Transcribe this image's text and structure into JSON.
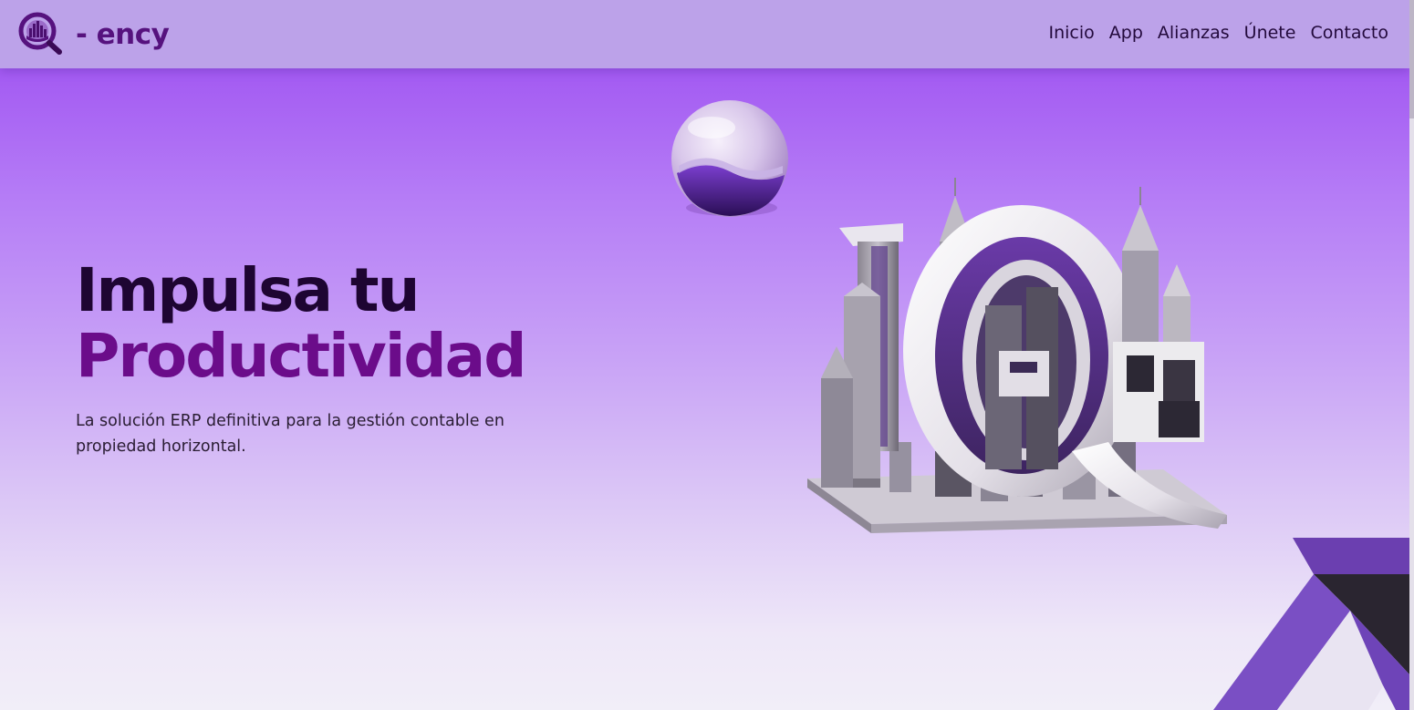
{
  "header": {
    "brand": "- ency",
    "nav": [
      {
        "label": "Inicio"
      },
      {
        "label": "App"
      },
      {
        "label": "Alianzas"
      },
      {
        "label": "Únete"
      },
      {
        "label": "Contacto"
      }
    ]
  },
  "hero": {
    "title_line1": "Impulsa tu",
    "title_line2": "Productividad",
    "subtitle": "La solución ERP definitiva para la gestión contable en propiedad horizontal.",
    "illustration": "3d-city-skyline-10q-icon",
    "decoration": [
      "glass-sphere-icon",
      "corner-chevron-shape"
    ]
  },
  "colors": {
    "header_bg": "#bca2e9",
    "brand_text": "#56127e",
    "hero_top": "#a35af2",
    "hero_bottom": "#f1eef8",
    "title_dark": "#1e0532",
    "title_accent": "#6b0c8a"
  }
}
